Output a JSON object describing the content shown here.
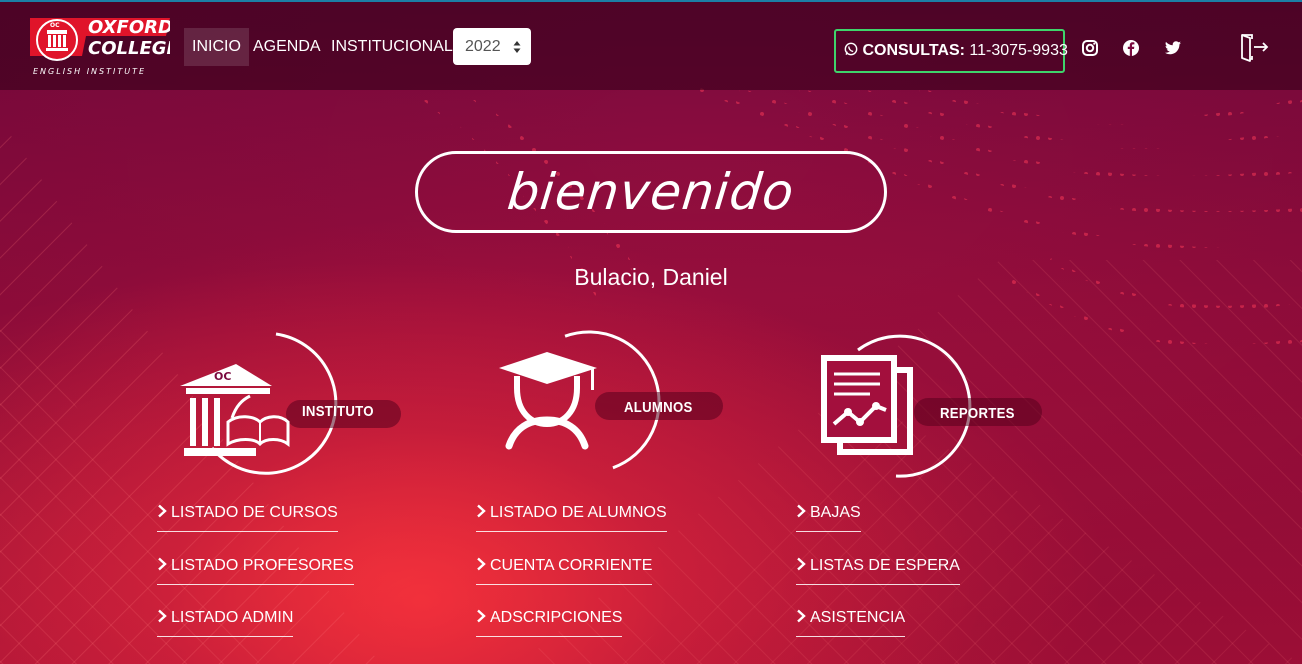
{
  "brand": {
    "logo_line1": "OXFORD",
    "logo_line2": "COLLEGE",
    "logo_tagline": "ENGLISH INSTITUTE",
    "logo_badge": "OC"
  },
  "nav": {
    "items": [
      "INICIO",
      "AGENDA",
      "INSTITUCIONAL"
    ],
    "year_selected": "2022"
  },
  "contact": {
    "icon": "whatsapp-icon",
    "label": "CONSULTAS:",
    "phone": "11-3075-9933",
    "border_color": "#3fd46b"
  },
  "social_icons": [
    "instagram-icon",
    "facebook-icon",
    "twitter-icon"
  ],
  "logout_icon": "logout-icon",
  "welcome": {
    "title": "bienvenido",
    "user_name": "Bulacio, Daniel"
  },
  "sections": [
    {
      "label": "INSTITUTO",
      "icon": "institute-building-icon",
      "icon_badge": "OC",
      "links": [
        "LISTADO DE CURSOS",
        "LISTADO PROFESORES",
        "LISTADO ADMIN"
      ]
    },
    {
      "label": "ALUMNOS",
      "icon": "graduate-student-icon",
      "links": [
        "LISTADO DE ALUMNOS",
        "CUENTA CORRIENTE",
        "ADSCRIPCIONES"
      ]
    },
    {
      "label": "REPORTES",
      "icon": "reports-chart-icon",
      "links": [
        "BAJAS",
        "LISTAS DE ESPERA",
        "ASISTENCIA"
      ]
    }
  ],
  "colors": {
    "brand_red": "#e0142a",
    "background": "#a30f3d",
    "top_line": "#1c7fa6"
  }
}
